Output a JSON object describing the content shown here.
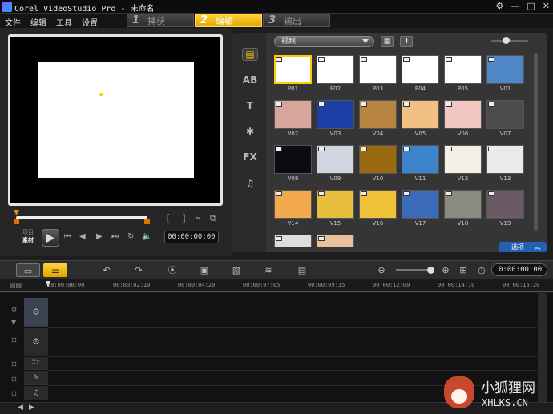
{
  "window": {
    "title": "Corel VideoStudio Pro - 未命名",
    "controls": [
      "⚙",
      "—",
      "□",
      "✕"
    ]
  },
  "menu": [
    "文件",
    "编辑",
    "工具",
    "设置"
  ],
  "steps": [
    {
      "num": "1",
      "label": "捕获",
      "active": false
    },
    {
      "num": "2",
      "label": "编辑",
      "active": true
    },
    {
      "num": "3",
      "label": "输出",
      "active": false
    }
  ],
  "player": {
    "trim_in": "[",
    "trim_out": "]",
    "project_label": "项目",
    "clip_label": "素材",
    "timecode": "00:00:00:00"
  },
  "library": {
    "sidebar": [
      {
        "name": "media-library-icon",
        "glyph": "▤",
        "active": true
      },
      {
        "name": "transition-icon",
        "glyph": "AB",
        "active": false
      },
      {
        "name": "title-icon",
        "glyph": "T",
        "active": false
      },
      {
        "name": "graphic-icon",
        "glyph": "✱",
        "active": false
      },
      {
        "name": "filter-icon",
        "glyph": "FX",
        "active": false
      },
      {
        "name": "audio-icon",
        "glyph": "♫",
        "active": false
      }
    ],
    "dropdown": "视频",
    "options_label": "选项",
    "items": [
      {
        "label": "P01",
        "bg": "#ffffff",
        "selected": true
      },
      {
        "label": "P02",
        "bg": "#ffffff",
        "selected": false
      },
      {
        "label": "P03",
        "bg": "#ffffff",
        "selected": false
      },
      {
        "label": "P04",
        "bg": "#ffffff",
        "selected": false
      },
      {
        "label": "P05",
        "bg": "#ffffff",
        "selected": false
      },
      {
        "label": "V01",
        "bg": "#4f86c6",
        "selected": false
      },
      {
        "label": "V02",
        "bg": "#d7a59a",
        "selected": false
      },
      {
        "label": "V03",
        "bg": "#1e3ea8",
        "selected": false
      },
      {
        "label": "V04",
        "bg": "#b7843f",
        "selected": false
      },
      {
        "label": "V05",
        "bg": "#f2c083",
        "selected": false
      },
      {
        "label": "V06",
        "bg": "#f1c6c0",
        "selected": false
      },
      {
        "label": "V07",
        "bg": "#4b4b4b",
        "selected": false
      },
      {
        "label": "V08",
        "bg": "#0c0c12",
        "selected": false
      },
      {
        "label": "V09",
        "bg": "#cfd6e0",
        "selected": false
      },
      {
        "label": "V10",
        "bg": "#9a6a10",
        "selected": false
      },
      {
        "label": "V11",
        "bg": "#3c83c9",
        "selected": false
      },
      {
        "label": "V12",
        "bg": "#f4f0e8",
        "selected": false
      },
      {
        "label": "V13",
        "bg": "#eaeaea",
        "selected": false
      },
      {
        "label": "V14",
        "bg": "#f3a94e",
        "selected": false
      },
      {
        "label": "V15",
        "bg": "#e6bd3c",
        "selected": false
      },
      {
        "label": "V16",
        "bg": "#f0c23a",
        "selected": false
      },
      {
        "label": "V17",
        "bg": "#3b6ab8",
        "selected": false
      },
      {
        "label": "V18",
        "bg": "#8a8a80",
        "selected": false
      },
      {
        "label": "V19",
        "bg": "#6a5a66",
        "selected": false
      },
      {
        "label": "",
        "bg": "#dedede",
        "selected": false
      },
      {
        "label": "",
        "bg": "#e9c29c",
        "selected": false
      }
    ]
  },
  "timeline": {
    "timecode": "0:00:00:00",
    "ruler": [
      "00:00:00:00",
      "00:00:02:10",
      "00:00:04:20",
      "00:00:07:05",
      "00:00:09:15",
      "00:00:12:00",
      "00:00:14:10",
      "00:00:16:20"
    ],
    "tracks": [
      "video",
      "overlay",
      "title",
      "voice",
      "music"
    ]
  },
  "watermark": {
    "line1": "小狐狸网",
    "line2": "XHLKS.CN"
  },
  "colors": {
    "accent": "#ffcc00",
    "options_bg": "#2360b0"
  }
}
